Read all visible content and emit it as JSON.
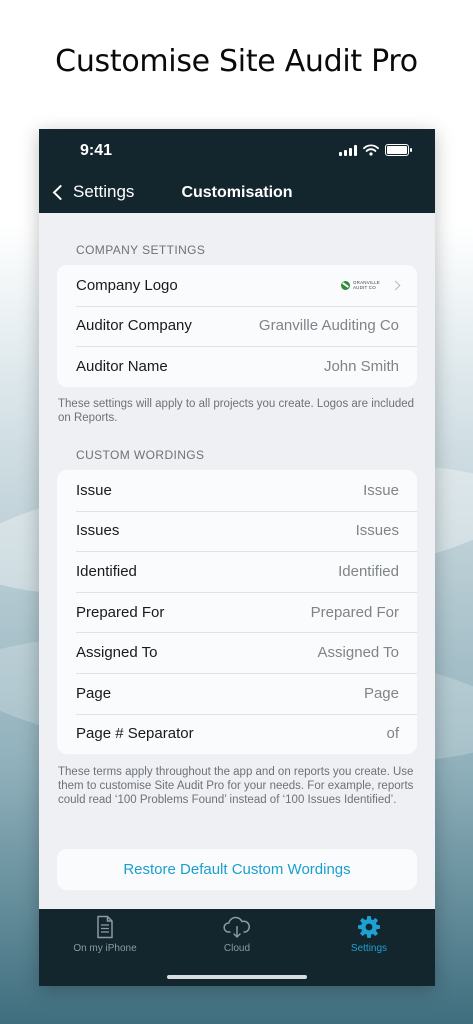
{
  "headline": "Customise Site Audit Pro",
  "status_bar": {
    "time": "9:41"
  },
  "nav": {
    "back_label": "Settings",
    "title": "Customisation"
  },
  "company_settings": {
    "header": "COMPANY SETTINGS",
    "rows": [
      {
        "label": "Company Logo",
        "logo_text_1": "GRANVILLE",
        "logo_text_2": "AUDIT CO"
      },
      {
        "label": "Auditor Company",
        "value": "Granville Auditing Co"
      },
      {
        "label": "Auditor Name",
        "value": "John Smith"
      }
    ],
    "footnote": "These settings will apply to all projects you create. Logos are included on Reports."
  },
  "custom_wordings": {
    "header": "CUSTOM WORDINGS",
    "rows": [
      {
        "label": "Issue",
        "value": "Issue"
      },
      {
        "label": "Issues",
        "value": "Issues"
      },
      {
        "label": "Identified",
        "value": "Identified"
      },
      {
        "label": "Prepared For",
        "value": "Prepared For"
      },
      {
        "label": "Assigned To",
        "value": "Assigned To"
      },
      {
        "label": "Page",
        "value": "Page"
      },
      {
        "label": "Page # Separator",
        "value": "of"
      }
    ],
    "footnote": "These terms apply throughout the app and on reports you create. Use them to customise Site Audit Pro for your needs. For example, reports could read ‘100 Problems Found’ instead of ‘100 Issues Identified’."
  },
  "restore_button": "Restore Default Custom Wordings",
  "tabs": [
    {
      "label": "On my iPhone",
      "icon": "document-icon",
      "active": false
    },
    {
      "label": "Cloud",
      "icon": "cloud-icon",
      "active": false
    },
    {
      "label": "Settings",
      "icon": "gear-icon",
      "active": true
    }
  ],
  "colors": {
    "bar": "#13262d",
    "accent": "#1ea0d2",
    "background": "#eef0f3"
  }
}
